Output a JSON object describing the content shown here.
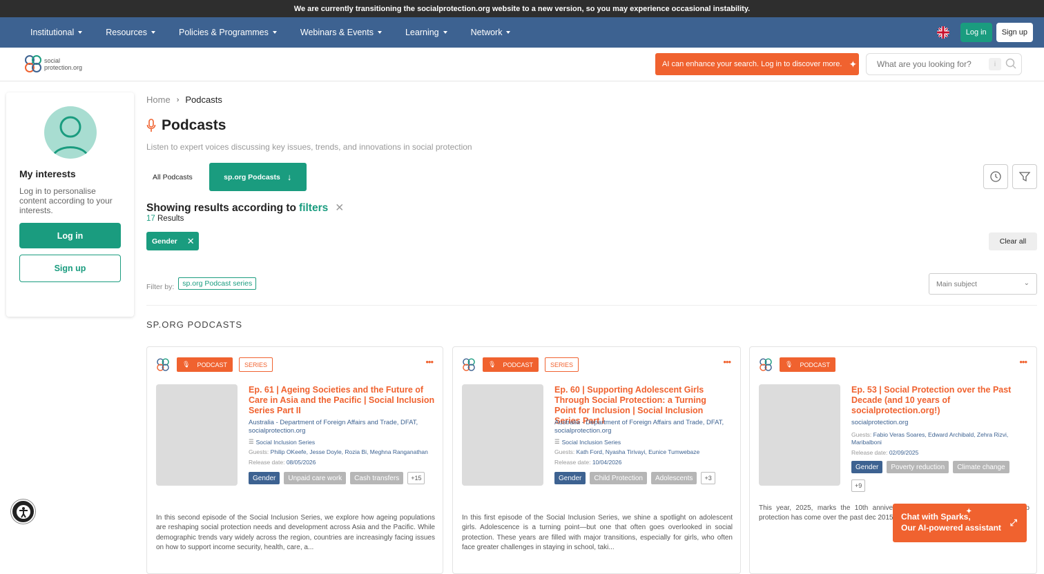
{
  "banner": {
    "text": "We are currently transitioning the socialprotection.org website to a new version, so you may experience occasional instability."
  },
  "topnav": {
    "items": [
      "Institutional",
      "Resources",
      "Policies & Programmes",
      "Webinars & Events",
      "Learning",
      "Network"
    ],
    "login": "Log in",
    "signup": "Sign up",
    "flag_icon": "uk-flag-icon"
  },
  "header": {
    "logo_line1": "social",
    "logo_line2": "protection.org",
    "ai_button": "AI can enhance your search. Log in to discover more.",
    "search_placeholder": "What are you looking for?",
    "search_kbd": "i"
  },
  "sidebar": {
    "title": "My interests",
    "description": "Log in to personalise content according to your interests.",
    "login": "Log in",
    "signup": "Sign up"
  },
  "main": {
    "breadcrumb": {
      "home": "Home",
      "current": "Podcasts"
    },
    "title": "Podcasts",
    "subtitle": "Listen to expert voices discussing key issues, trends, and innovations in social protection",
    "tabs": {
      "all": "All Podcasts",
      "sp": "sp.org Podcasts"
    },
    "showing_prefix": "Showing results according to",
    "showing_link": "filters",
    "results_count": "17",
    "results_label": "Results",
    "active_filter": "Gender",
    "clear_all": "Clear all",
    "filter_by_label": "Filter by:",
    "filter_by_tag": "sp.org Podcast series",
    "main_subject": "Main subject",
    "section_header": "SP.ORG PODCASTS"
  },
  "cards": [
    {
      "badge": "PODCAST",
      "series_badge": "SERIES",
      "title": "Ep. 61 | Ageing Societies and the Future of Care in Asia and the Pacific | Social Inclusion Series Part II",
      "org": "Australia - Department of Foreign Affairs and Trade, DFAT, socialprotection.org",
      "series": "Social Inclusion Series",
      "guests_label": "Guests:",
      "guests": "Philip OKeefe, Jesse Doyle, Rozia Bi, Meghna Ranganathan",
      "date_label": "Release date:",
      "date": "08/05/2026",
      "tags": [
        "Gender",
        "Unpaid care work",
        "Cash transfers"
      ],
      "more": "+15",
      "desc": "In this second episode of the Social Inclusion Series, we explore how ageing populations are reshaping social protection needs and development across Asia and the Pacific. While demographic trends vary widely across the region, countries are increasingly facing issues on how to support income security, health, care, a..."
    },
    {
      "badge": "PODCAST",
      "series_badge": "SERIES",
      "title": "Ep. 60 | Supporting Adolescent Girls Through Social Protection: a Turning Point for Inclusion | Social Inclusion Series Part I",
      "org": "Australia - Department of Foreign Affairs and Trade, DFAT, socialprotection.org",
      "series": "Social Inclusion Series",
      "guests_label": "Guests:",
      "guests": "Kath Ford, Nyasha Tirivayi, Eunice Tumwebaze",
      "date_label": "Release date:",
      "date": "10/04/2026",
      "tags": [
        "Gender",
        "Child Protection",
        "Adolescents"
      ],
      "more": "+3",
      "desc": "In this first episode of the Social Inclusion Series, we shine a spotlight on adolescent girls. Adolescence is a turning point—but one that often goes overlooked in social protection. These years are filled with major transitions, especially for girls, who often face greater challenges in staying in school, taki..."
    },
    {
      "badge": "PODCAST",
      "title": "Ep. 53 | Social Protection over the Past Decade (and 10 years of socialprotection.org!)",
      "org": "socialprotection.org",
      "guests_label": "Guests:",
      "guests": "Fabio Veras Soares, Edward Archibald, Zehra Rizvi, Maribalboni",
      "date_label": "Release date:",
      "date": "02/09/2025",
      "tags": [
        "Gender",
        "Poverty reduction",
        "Climate change"
      ],
      "more": "+9",
      "desc": "This year, 2025, marks the 10th anniversa milestone that offers the perfect opp protection has come over the past dec 2015, when social protection was anchor"
    }
  ],
  "chat": {
    "line1": "Chat with Sparks,",
    "line2": "Our AI-powered assistant"
  },
  "colors": {
    "accent_green": "#1a9c7f",
    "nav_blue": "#3d6291",
    "orange": "#f0622f"
  }
}
